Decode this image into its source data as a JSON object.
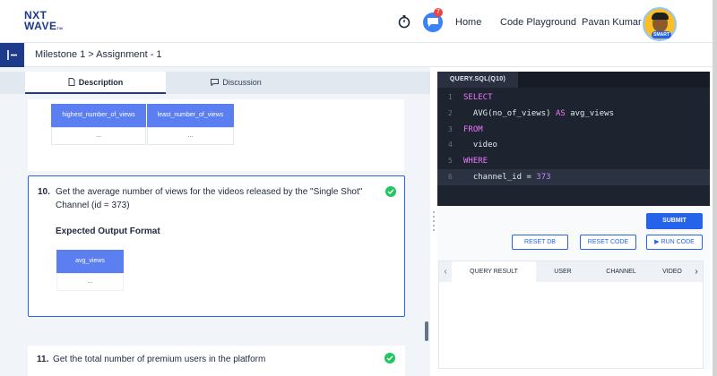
{
  "header": {
    "logo_line1": "NXT",
    "logo_line2": "WAVE",
    "logo_tm": "TM",
    "notification_count": "7",
    "nav": {
      "home": "Home",
      "code_playground": "Code Playground"
    },
    "user_name": "Pavan Kumar",
    "avatar_badge": "SMART"
  },
  "breadcrumb": "Milestone 1 > Assignment - 1",
  "tabs": {
    "description": "Description",
    "discussion": "Discussion"
  },
  "prev_card": {
    "headers": [
      "highest_number_of_views",
      "least_number_of_views"
    ],
    "cells": [
      "...",
      "..."
    ]
  },
  "question10": {
    "number": "10.",
    "text": "Get the average number of views for the videos released by the \"Single Shot\" Channel (id = 373)",
    "expected_heading": "Expected Output Format",
    "column": "avg_views",
    "cell": "..."
  },
  "question11": {
    "number": "11.",
    "text": "Get the total number of premium users in the platform"
  },
  "editor": {
    "tab_label": "QUERY.SQL(Q10)",
    "lines": [
      {
        "n": "1",
        "kw": "SELECT",
        "rest": ""
      },
      {
        "n": "2",
        "pre": "  AVG(no_of_views) ",
        "kw": "AS",
        "rest": " avg_views"
      },
      {
        "n": "3",
        "kw": "FROM",
        "rest": ""
      },
      {
        "n": "4",
        "pre": "  video"
      },
      {
        "n": "5",
        "kw": "WHERE",
        "rest": ""
      },
      {
        "n": "6",
        "pre": "  channel_id = ",
        "num": "373"
      }
    ]
  },
  "buttons": {
    "submit": "SUBMIT",
    "reset_db": "RESET DB",
    "reset_code": "RESET CODE",
    "run_code": "RUN CODE"
  },
  "result_tabs": [
    "QUERY RESULT",
    "USER",
    "CHANNEL",
    "VIDEO"
  ],
  "colors": {
    "brand": "#1e3a8a",
    "accent": "#2563eb",
    "success": "#22c55e",
    "table_header": "#5b7ff0",
    "editor_bg": "#1e2330"
  }
}
